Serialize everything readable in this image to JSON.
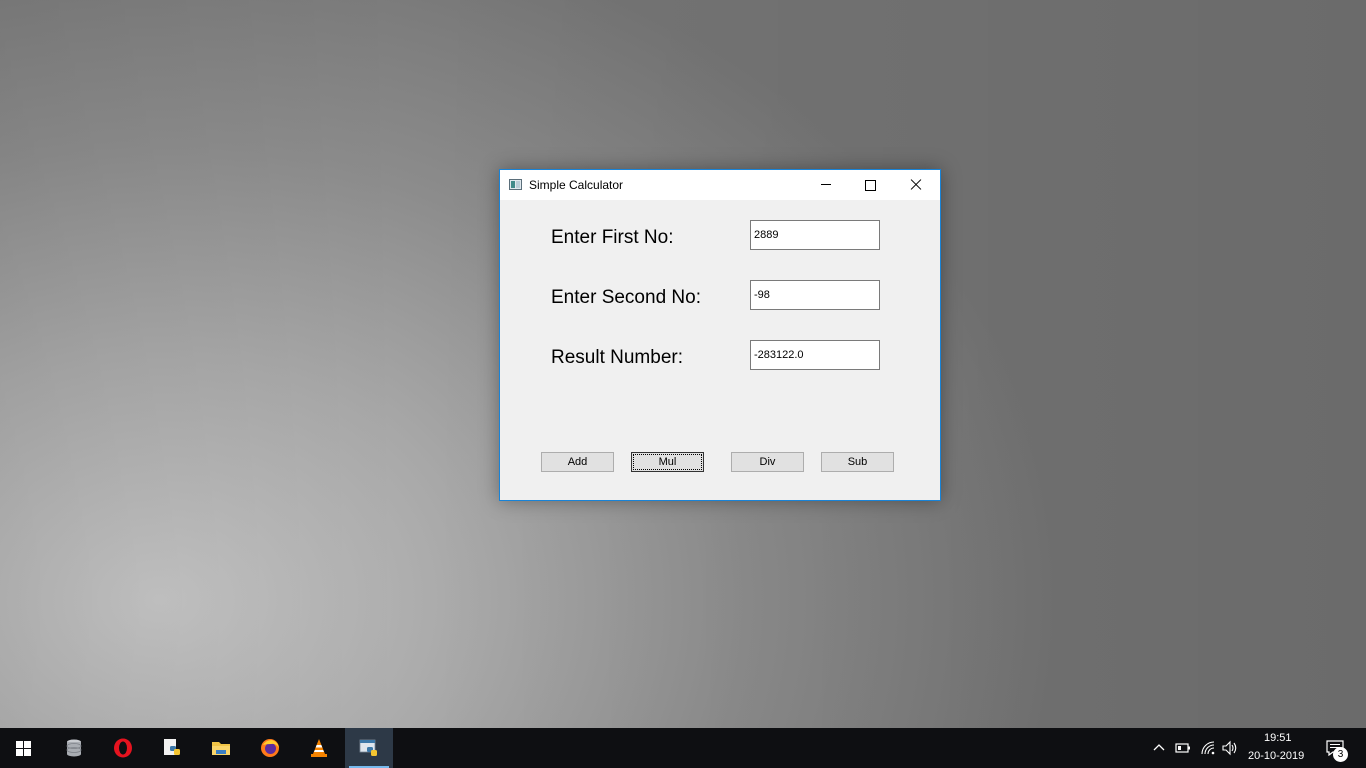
{
  "window": {
    "title": "Simple Calculator",
    "labels": {
      "first": "Enter First No:",
      "second": "Enter Second No:",
      "result": "Result Number:"
    },
    "fields": {
      "first": "2889",
      "second": "-98",
      "result": "-283122.0"
    },
    "buttons": {
      "add": "Add",
      "mul": "Mul",
      "div": "Div",
      "sub": "Sub"
    },
    "focused_button": "Mul"
  },
  "taskbar": {
    "apps": [
      "start",
      "database-app",
      "opera",
      "python-idle",
      "file-explorer",
      "firefox",
      "vlc",
      "python-tk-window"
    ],
    "active_app": "python-tk-window",
    "clock_time": "19:51",
    "clock_date": "20-10-2019",
    "notification_count": "3"
  },
  "colors": {
    "window_border": "#1883d7",
    "taskbar_bg": "#0e0f12",
    "button_face": "#e1e1e1"
  }
}
